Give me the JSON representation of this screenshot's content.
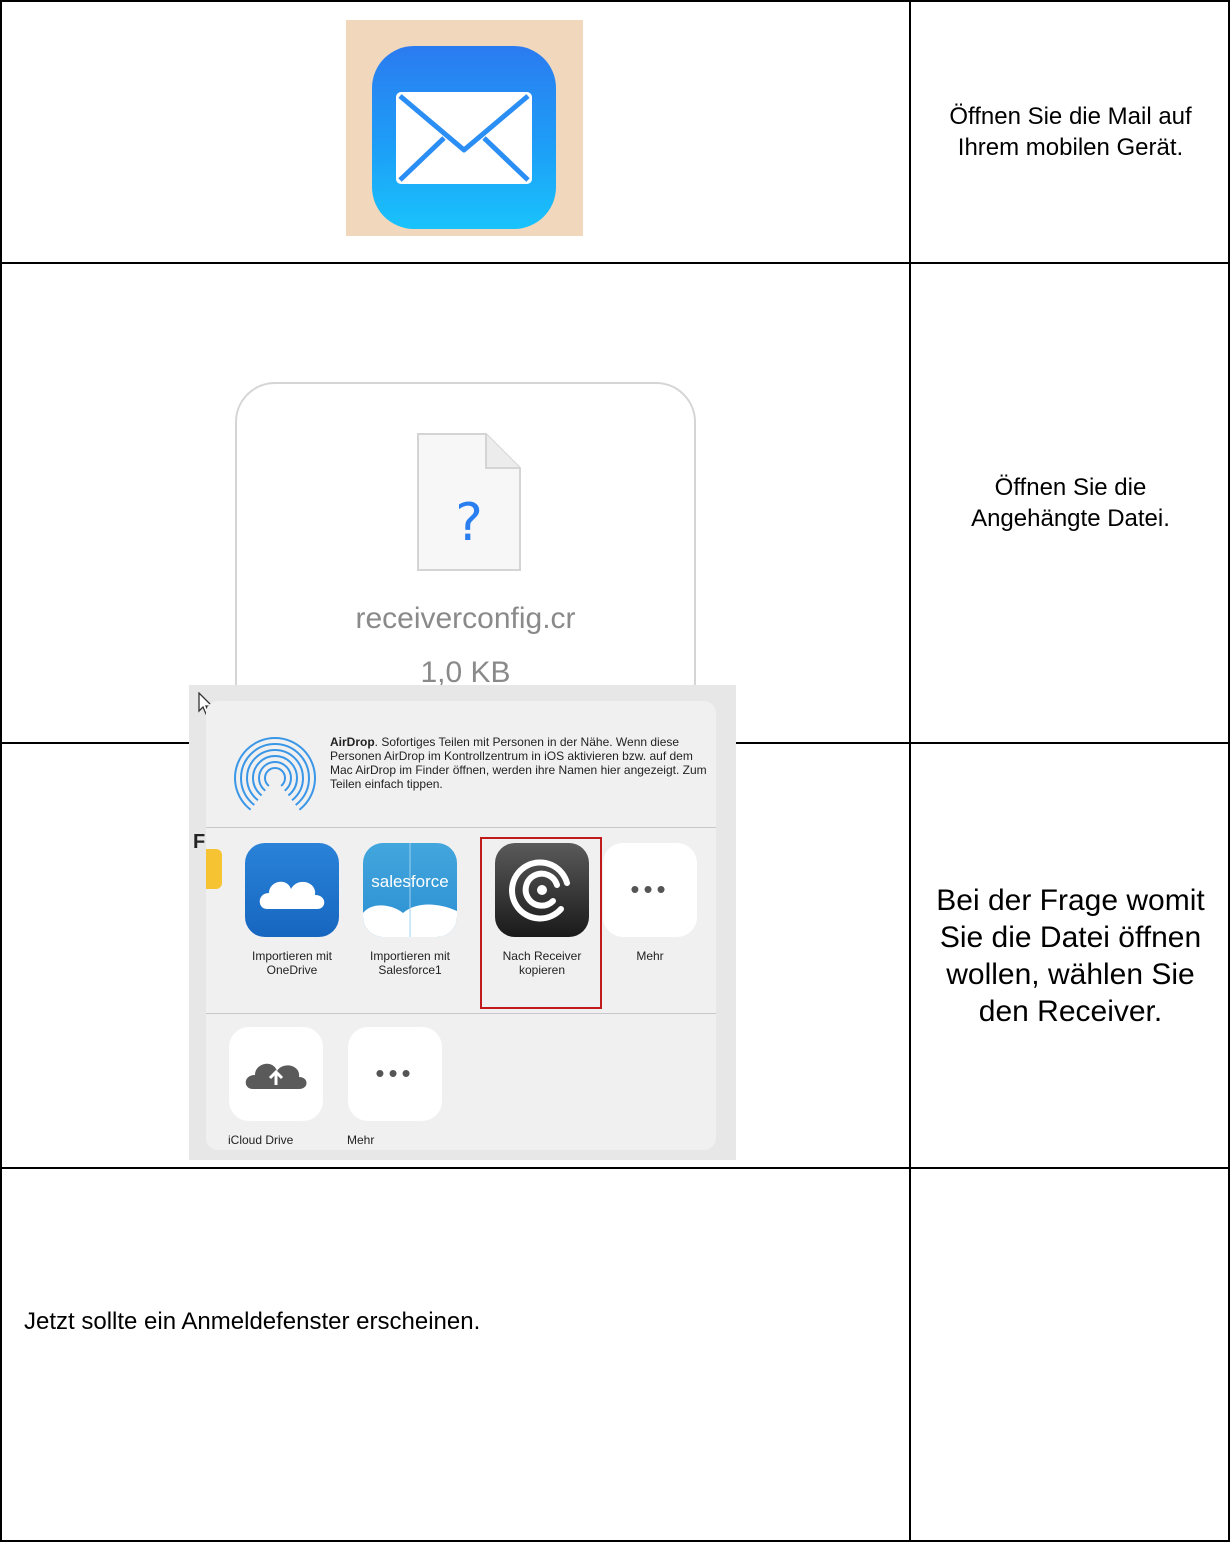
{
  "rows": [
    {
      "instruction_lines": [
        "Öffnen Sie die Mail auf",
        "Ihrem mobilen Gerät."
      ]
    },
    {
      "attachment": {
        "file_name": "receiverconfig.cr",
        "file_size": "1,0 KB",
        "file_icon_glyph": "?"
      },
      "instruction_lines": [
        "Öffnen Sie die",
        "Angehängte Datei."
      ]
    },
    {
      "share_sheet": {
        "airdrop_title": "AirDrop",
        "airdrop_description": ". Sofortiges Teilen mit Personen in der Nähe. Wenn diese Personen AirDrop im Kontrollzentrum in iOS aktivieren bzw. auf dem Mac AirDrop im Finder öffnen, werden ihre Namen hier angezeigt. Zum Teilen einfach tippen.",
        "left_partial_letter": "F",
        "left_partial_label": "\"",
        "apps": [
          {
            "label_1": "Importieren mit",
            "label_2": "OneDrive",
            "icon": "onedrive-cloud-icon"
          },
          {
            "label_1": "Importieren mit",
            "label_2": "Salesforce1",
            "icon": "salesforce-cloud-icon",
            "logo_text": "salesforce"
          },
          {
            "label_1": "Nach Receiver",
            "label_2": "kopieren",
            "icon": "receiver-icon"
          },
          {
            "label_1": "Mehr",
            "label_2": "",
            "icon": "more-dots-icon"
          }
        ],
        "actions": [
          {
            "label": "iCloud Drive",
            "icon": "icloud-upload-icon"
          },
          {
            "label": "Mehr",
            "icon": "more-dots-icon"
          }
        ],
        "dots": "•••"
      },
      "instruction_lines": [
        "Bei der Frage womit",
        "Sie die Datei öffnen",
        "wollen, wählen Sie",
        "den Receiver."
      ]
    },
    {
      "instruction": "Jetzt sollte ein Anmeldefenster erscheinen."
    }
  ],
  "colors": {
    "mail_background": "#f1d8bd",
    "mail_blue": "#1d9ef7",
    "highlight_red": "#c01a1a"
  }
}
